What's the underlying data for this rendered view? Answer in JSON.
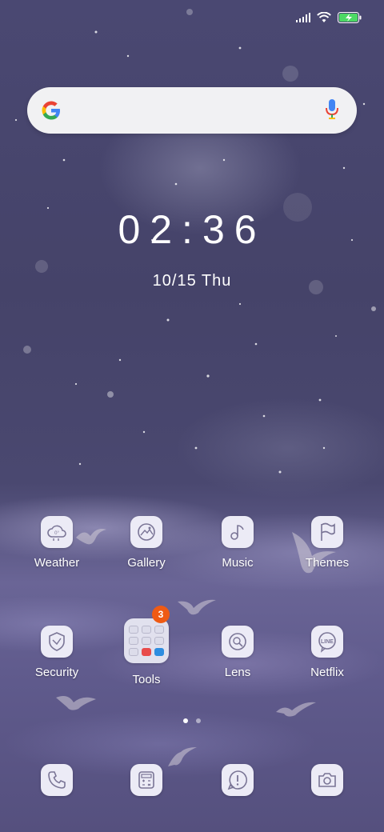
{
  "status_bar": {
    "icons": [
      "signal-icon",
      "wifi-icon",
      "battery-charging-icon"
    ],
    "battery_color": "#4cd964"
  },
  "search_bar": {
    "logo": "google-logo",
    "mic_icon": "microphone-icon"
  },
  "clock": {
    "time": "02:36",
    "date": "10/15 Thu"
  },
  "apps": {
    "row1": [
      {
        "label": "Weather",
        "icon": "cloud-icon"
      },
      {
        "label": "Gallery",
        "icon": "image-icon"
      },
      {
        "label": "Music",
        "icon": "music-note-icon"
      },
      {
        "label": "Themes",
        "icon": "flag-icon"
      }
    ],
    "row2": [
      {
        "label": "Security",
        "icon": "shield-icon"
      },
      {
        "label": "Tools",
        "icon": "folder-icon",
        "badge": "3"
      },
      {
        "label": "Lens",
        "icon": "lens-icon"
      },
      {
        "label": "Netflix",
        "icon": "line-icon",
        "icon_text": "LINE"
      }
    ]
  },
  "page_indicator": {
    "count": 2,
    "active": 1
  },
  "dock": [
    {
      "icon": "phone-icon"
    },
    {
      "icon": "calculator-icon"
    },
    {
      "icon": "message-alert-icon"
    },
    {
      "icon": "camera-icon"
    }
  ],
  "colors": {
    "badge": "#ef5a14",
    "icon_stroke": "#7a7596",
    "tile": "#ecebf6"
  }
}
